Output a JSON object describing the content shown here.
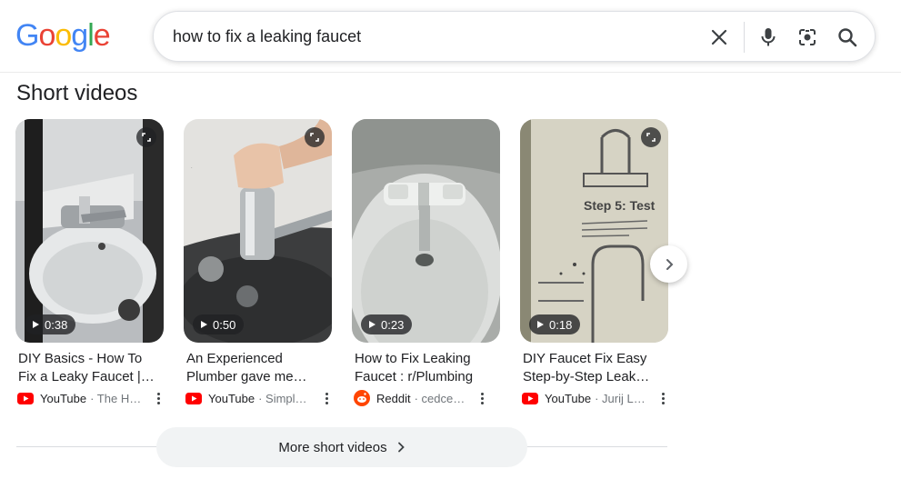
{
  "logo": {
    "letters": [
      "G",
      "o",
      "o",
      "g",
      "l",
      "e"
    ],
    "colors": [
      "#4285F4",
      "#EA4335",
      "#FBBC05",
      "#4285F4",
      "#34A853",
      "#EA4335"
    ]
  },
  "search": {
    "query": "how to fix a leaking faucet"
  },
  "icons": {
    "clear": "close-icon",
    "voice": "mic-icon",
    "lens": "lens-icon",
    "search": "search-icon"
  },
  "section": {
    "title": "Short videos"
  },
  "videos": [
    {
      "title": "DIY Basics - How To Fix a Leaky Faucet |…",
      "duration": "0:38",
      "source": "YouTube",
      "author": "· The H…",
      "source_icon": "youtube-icon"
    },
    {
      "title": "An Experienced Plumber gave me…",
      "duration": "0:50",
      "source": "YouTube",
      "author": "· Simpl…",
      "source_icon": "youtube-icon"
    },
    {
      "title": "How to Fix Leaking Faucet : r/Plumbing",
      "duration": "0:23",
      "source": "Reddit",
      "author": "· cedcedd…",
      "source_icon": "reddit-icon"
    },
    {
      "title": "DIY Faucet Fix Easy Step-by-Step Leak…",
      "duration": "0:18",
      "source": "YouTube",
      "author": "· Jurij L…",
      "source_icon": "youtube-icon"
    }
  ],
  "thumb4_text": {
    "heading": "Step 5: Test"
  },
  "more": {
    "label": "More short videos"
  },
  "colors": {
    "youtube": "#FF0000",
    "reddit": "#FF4500",
    "accent_gray": "#f1f3f4"
  }
}
